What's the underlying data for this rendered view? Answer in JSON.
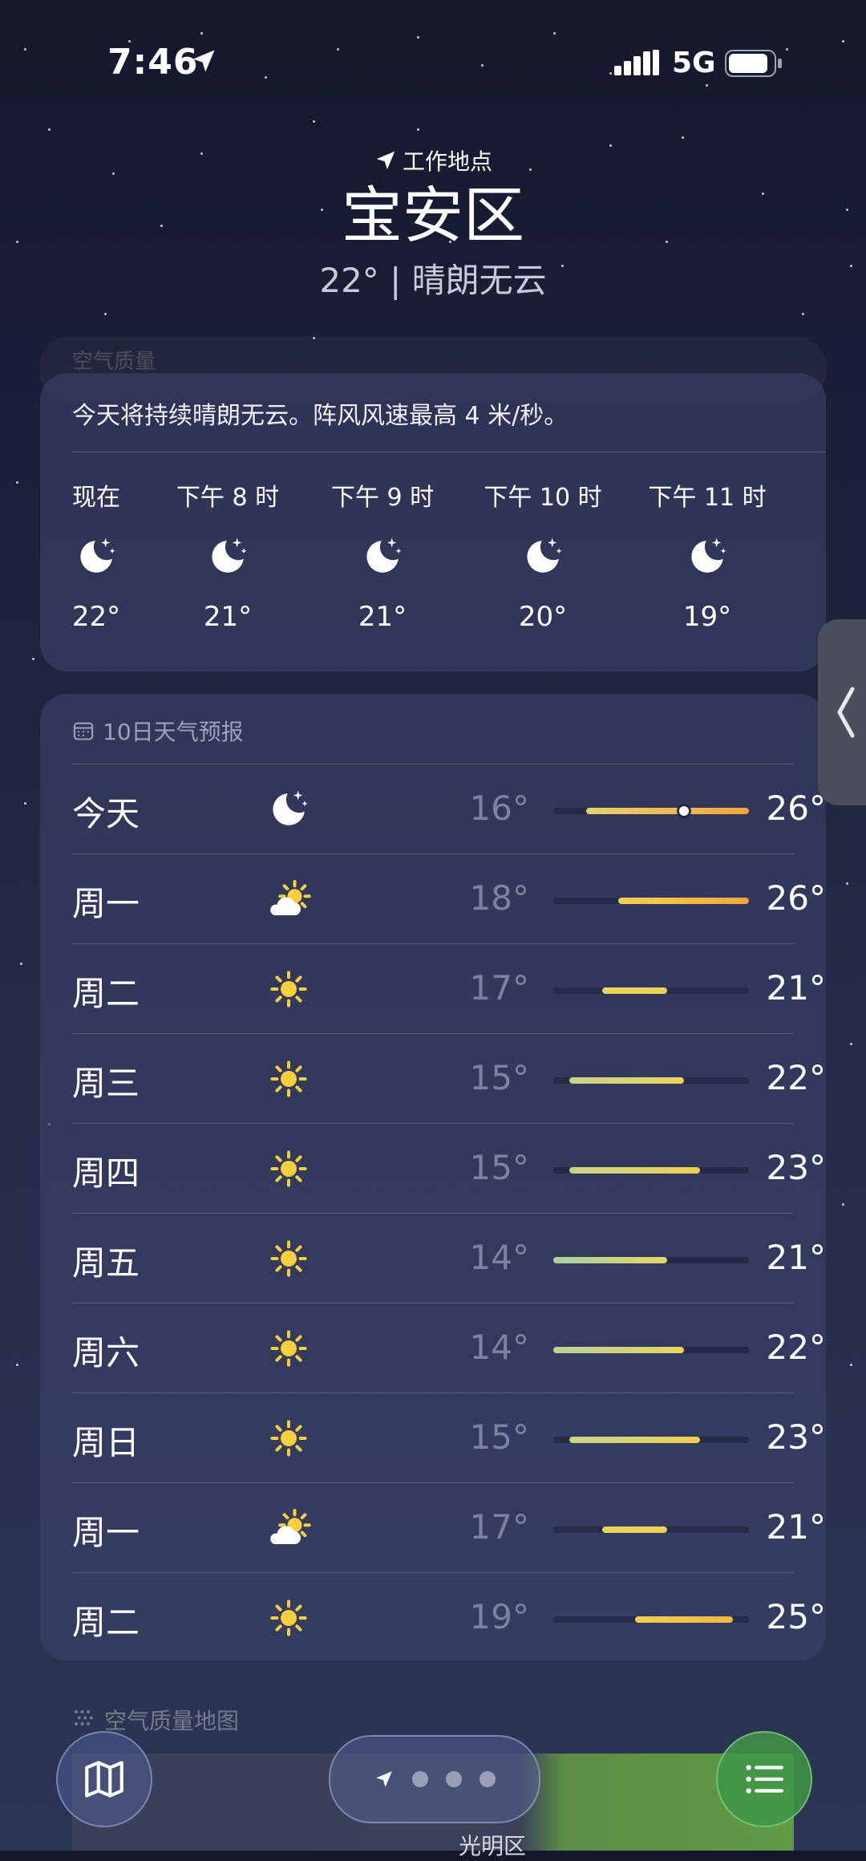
{
  "status": {
    "time": "7:46",
    "network": "5G"
  },
  "header": {
    "location_label": "工作地点",
    "city": "宝安区",
    "summary": "22°  |  晴朗无云"
  },
  "ghost_card": {
    "label": "空气质量"
  },
  "hourly": {
    "description": "今天将持续晴朗无云。阵风风速最高 4 米/秒。",
    "items": [
      {
        "label": "现在",
        "temp": "22°",
        "icon": "moon-stars-icon"
      },
      {
        "label": "下午 8 时",
        "temp": "21°",
        "icon": "moon-stars-icon"
      },
      {
        "label": "下午 9 时",
        "temp": "21°",
        "icon": "moon-stars-icon"
      },
      {
        "label": "下午 10 时",
        "temp": "20°",
        "icon": "moon-stars-icon"
      },
      {
        "label": "下午 11 时",
        "temp": "19°",
        "icon": "moon-stars-icon"
      }
    ]
  },
  "daily": {
    "title": "10日天气预报",
    "range_min": 14,
    "range_max": 26,
    "days": [
      {
        "day": "今天",
        "icon": "moon-stars-icon",
        "lo": "16°",
        "hi": "26°",
        "lo_n": 16,
        "hi_n": 26,
        "current_n": 22,
        "colors": [
          "#e6d06a",
          "#f3a63d"
        ]
      },
      {
        "day": "周一",
        "icon": "cloud-sun-icon",
        "lo": "18°",
        "hi": "26°",
        "lo_n": 18,
        "hi_n": 26,
        "colors": [
          "#f3cf52",
          "#f3a63d"
        ]
      },
      {
        "day": "周二",
        "icon": "sun-icon",
        "lo": "17°",
        "hi": "21°",
        "lo_n": 17,
        "hi_n": 21,
        "colors": [
          "#e8d45c",
          "#f0cf55"
        ]
      },
      {
        "day": "周三",
        "icon": "sun-icon",
        "lo": "15°",
        "hi": "22°",
        "lo_n": 15,
        "hi_n": 22,
        "colors": [
          "#c6d48a",
          "#edd35a"
        ]
      },
      {
        "day": "周四",
        "icon": "sun-icon",
        "lo": "15°",
        "hi": "23°",
        "lo_n": 15,
        "hi_n": 23,
        "colors": [
          "#c6d48a",
          "#efcf52"
        ]
      },
      {
        "day": "周五",
        "icon": "sun-icon",
        "lo": "14°",
        "hi": "21°",
        "lo_n": 14,
        "hi_n": 21,
        "colors": [
          "#a9d0a4",
          "#e6d466"
        ]
      },
      {
        "day": "周六",
        "icon": "sun-icon",
        "lo": "14°",
        "hi": "22°",
        "lo_n": 14,
        "hi_n": 22,
        "colors": [
          "#b7d29a",
          "#ecd35e"
        ]
      },
      {
        "day": "周日",
        "icon": "sun-icon",
        "lo": "15°",
        "hi": "23°",
        "lo_n": 15,
        "hi_n": 23,
        "colors": [
          "#c6d48a",
          "#efcf52"
        ]
      },
      {
        "day": "周一",
        "icon": "cloud-sun-icon",
        "lo": "17°",
        "hi": "21°",
        "lo_n": 17,
        "hi_n": 21,
        "colors": [
          "#e8d45c",
          "#f0cf55"
        ]
      },
      {
        "day": "周二",
        "icon": "sun-icon",
        "lo": "19°",
        "hi": "25°",
        "lo_n": 19,
        "hi_n": 25,
        "colors": [
          "#f3cf52",
          "#f3b640"
        ]
      }
    ]
  },
  "air_quality_map": {
    "label": "空气质量地图",
    "district": "光明区"
  }
}
